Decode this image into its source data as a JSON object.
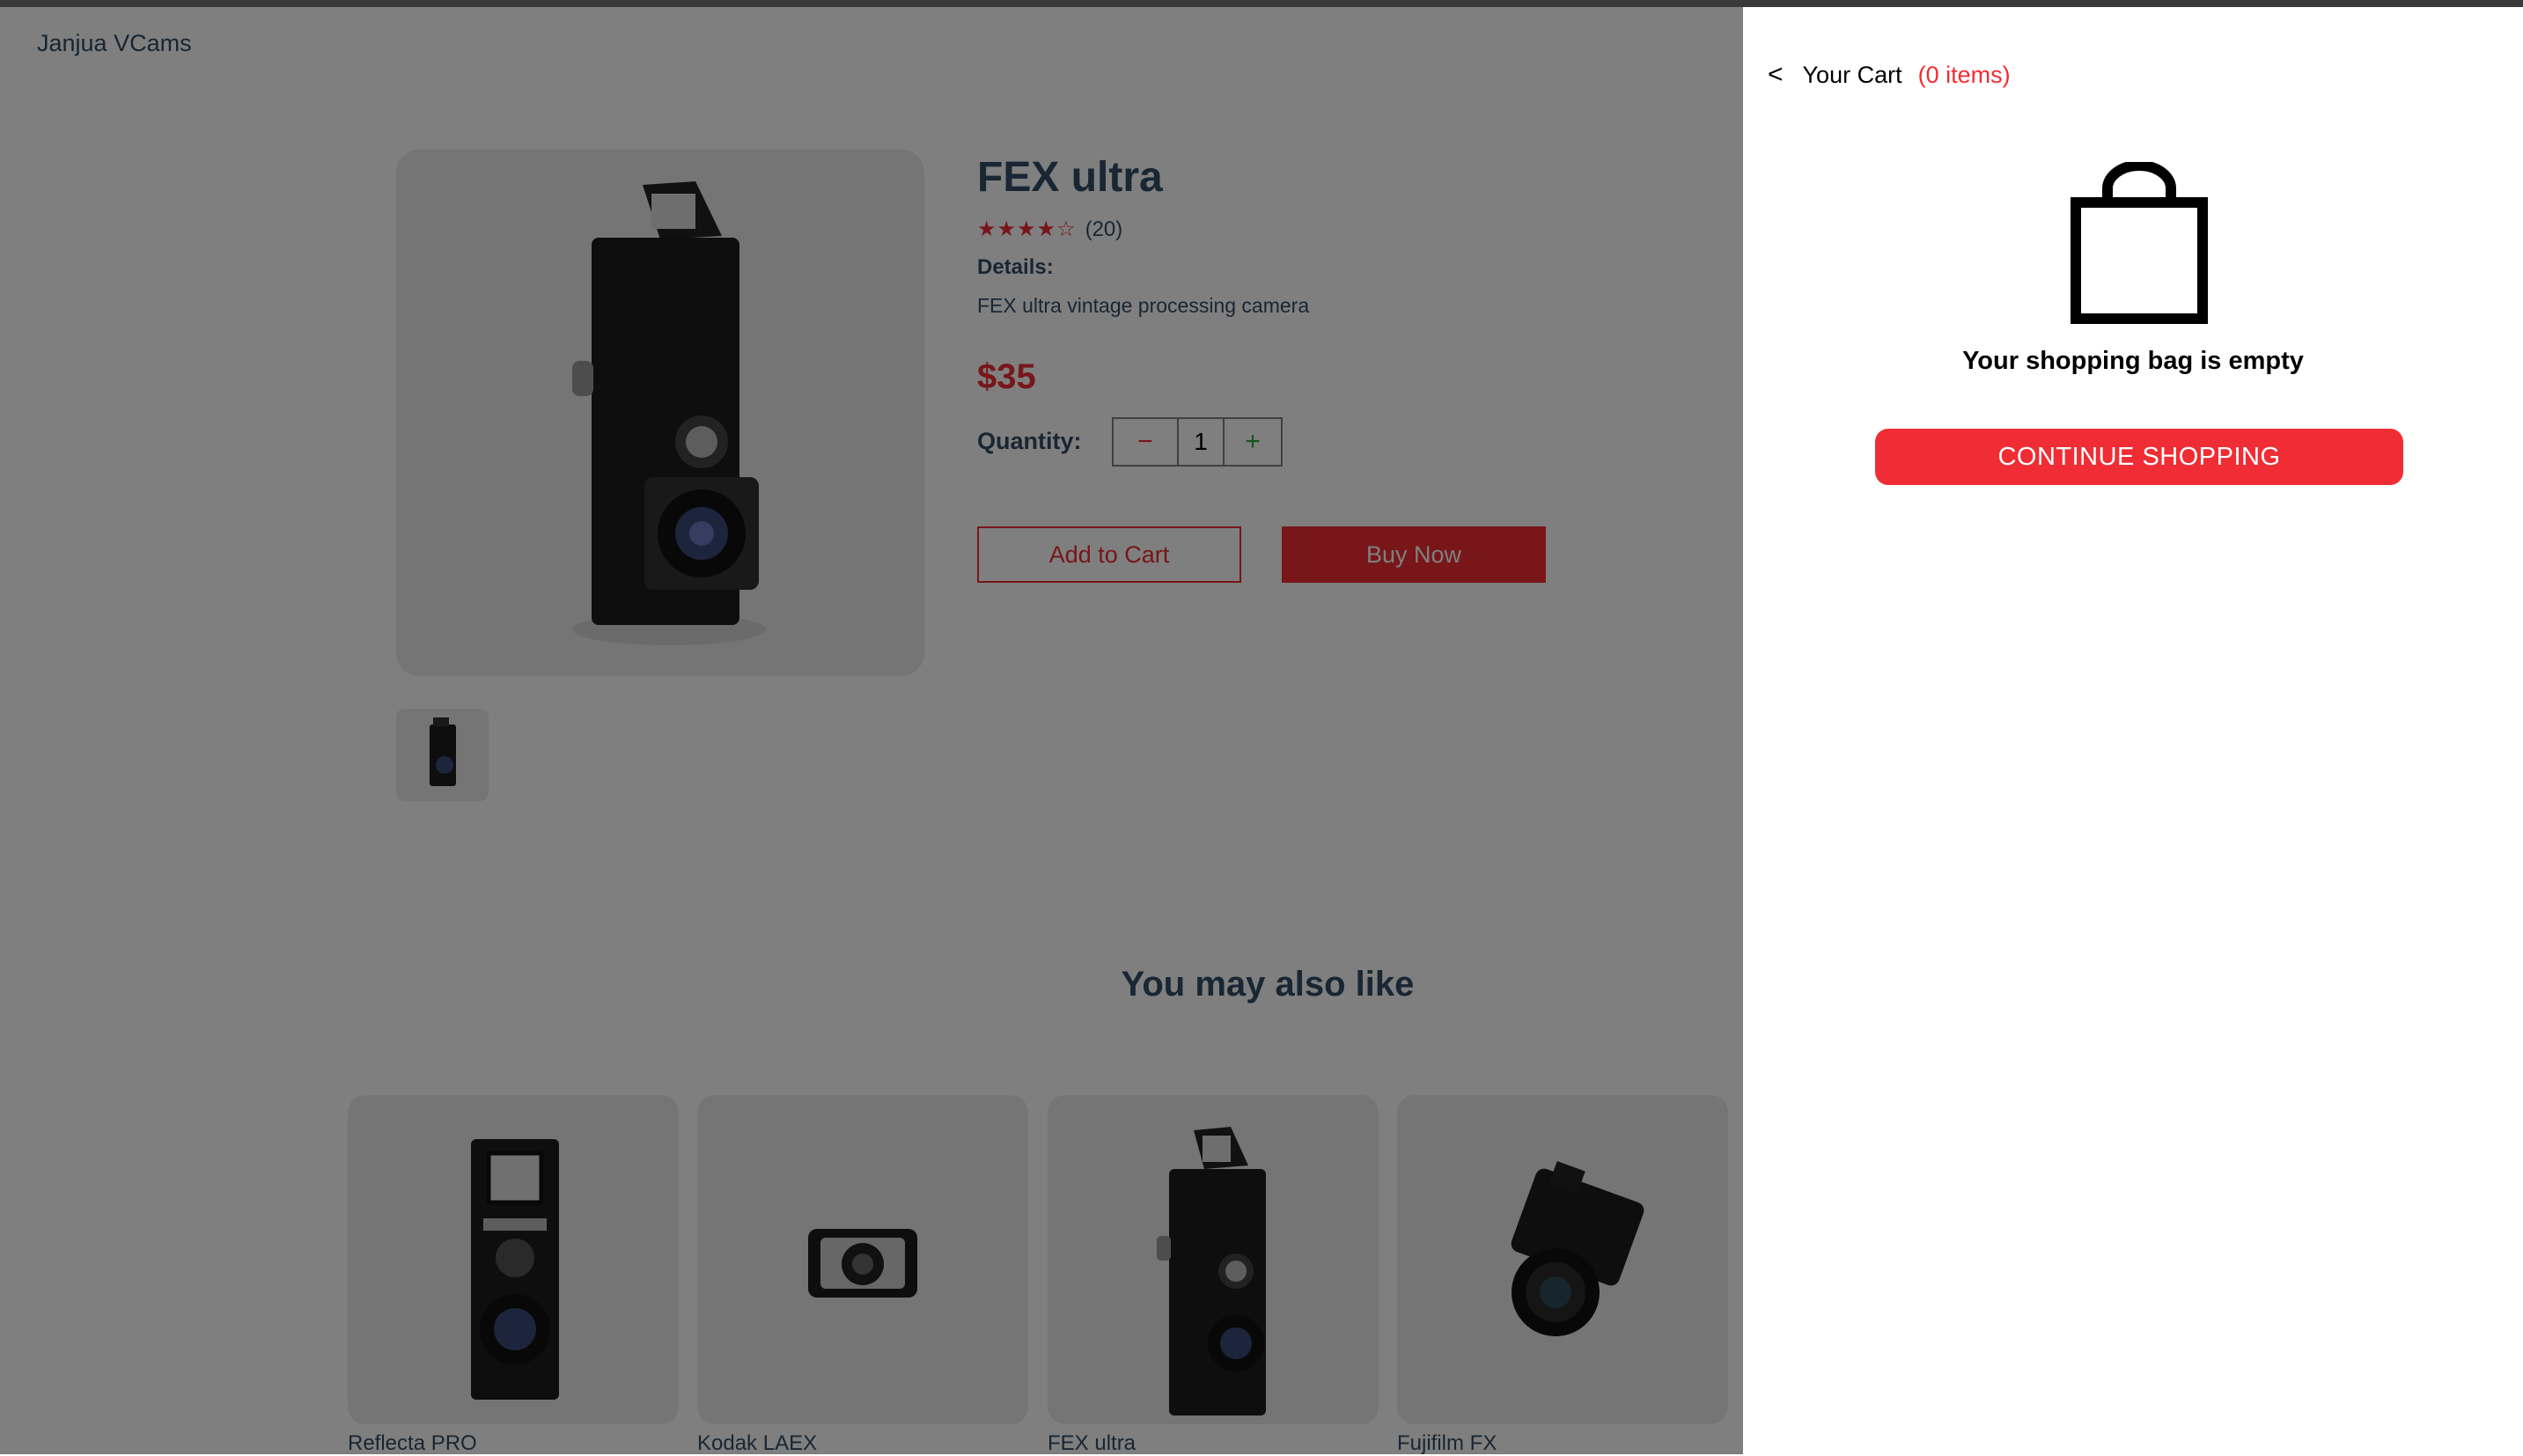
{
  "header": {
    "logo": "Janjua VCams"
  },
  "product": {
    "title": "FEX ultra",
    "stars": "★★★★☆",
    "review_count": "(20)",
    "details_heading": "Details:",
    "details_text": "FEX ultra vintage processing camera",
    "price": "$35",
    "quantity_label": "Quantity:",
    "quantity": "1",
    "minus_symbol": "−",
    "plus_symbol": "+",
    "add_to_cart_label": "Add to Cart",
    "buy_now_label": "Buy Now"
  },
  "recommendations": {
    "heading": "You may also like",
    "items": [
      {
        "name": "Reflecta PRO"
      },
      {
        "name": "Kodak LAEX"
      },
      {
        "name": "FEX ultra"
      },
      {
        "name": "Fujifilm FX"
      }
    ]
  },
  "cart": {
    "back_symbol": "<",
    "title": "Your Cart",
    "items_count": "(0 items)",
    "empty_message": "Your shopping bag is empty",
    "continue_label": "CONTINUE SHOPPING"
  },
  "colors": {
    "accent": "#f02d34",
    "text": "#324d67",
    "overlay": "rgba(0,0,0,0.5)",
    "image_bg": "#ebebeb"
  },
  "icons": {
    "back": "chevron-left-icon",
    "bag": "shopping-bag-icon",
    "stars": "star-icon"
  }
}
